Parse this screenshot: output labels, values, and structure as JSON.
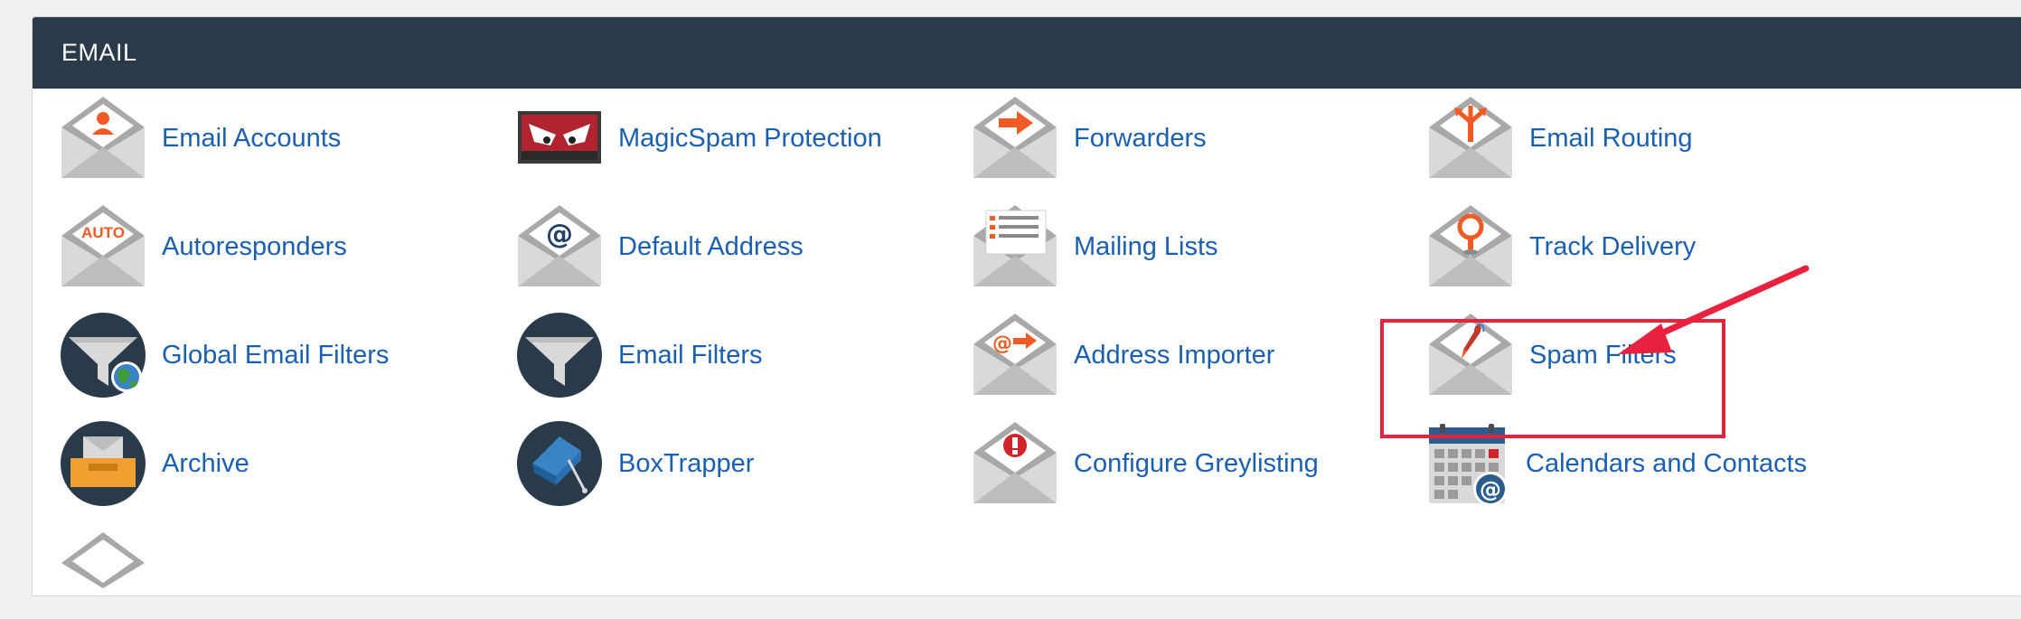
{
  "section": {
    "title": "EMAIL"
  },
  "colors": {
    "header_bg": "#293a4a",
    "link": "#1b5fb1",
    "accent_orange": "#f15a22",
    "annotation_red": "#e8223e"
  },
  "items": [
    {
      "label": "Email Accounts",
      "icon": "envelope-person-icon"
    },
    {
      "label": "MagicSpam Protection",
      "icon": "magicspam-eyes-icon"
    },
    {
      "label": "Forwarders",
      "icon": "envelope-arrow-icon"
    },
    {
      "label": "Email Routing",
      "icon": "envelope-routing-icon"
    },
    {
      "label": "Autoresponders",
      "icon": "envelope-auto-icon"
    },
    {
      "label": "Default Address",
      "icon": "envelope-at-icon"
    },
    {
      "label": "Mailing Lists",
      "icon": "envelope-list-icon"
    },
    {
      "label": "Track Delivery",
      "icon": "envelope-pin-icon"
    },
    {
      "label": "Global Email Filters",
      "icon": "funnel-globe-icon"
    },
    {
      "label": "Email Filters",
      "icon": "funnel-icon"
    },
    {
      "label": "Address Importer",
      "icon": "envelope-at-arrow-icon"
    },
    {
      "label": "Spam Filters",
      "icon": "envelope-brush-icon"
    },
    {
      "label": "Archive",
      "icon": "archive-box-icon"
    },
    {
      "label": "BoxTrapper",
      "icon": "boxtrapper-icon"
    },
    {
      "label": "Configure Greylisting",
      "icon": "envelope-alert-icon"
    },
    {
      "label": "Calendars and Contacts",
      "icon": "calendar-at-icon"
    }
  ],
  "annotation": {
    "target": "Spam Filters"
  }
}
